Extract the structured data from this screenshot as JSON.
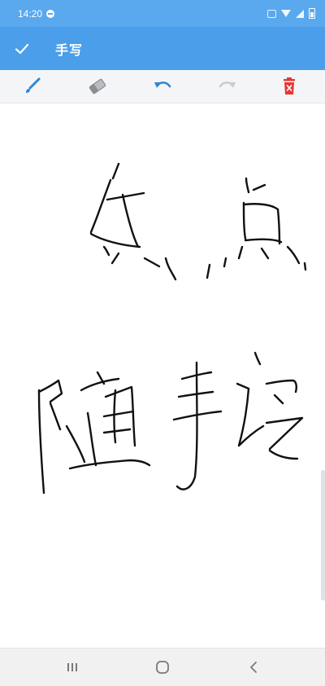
{
  "status_bar": {
    "time": "14:20"
  },
  "app_bar": {
    "title": "手写",
    "confirm_icon": "check-icon"
  },
  "toolbar": {
    "tools": [
      {
        "name": "brush-icon",
        "color": "#2f86d8"
      },
      {
        "name": "eraser-icon",
        "color": "#8a8d91"
      },
      {
        "name": "undo-icon",
        "color": "#2f86d8"
      },
      {
        "name": "redo-icon",
        "color": "#c9ccd0"
      },
      {
        "name": "delete-icon",
        "color": "#e53935"
      }
    ]
  },
  "canvas": {
    "handwriting_lines": [
      "点点",
      "随手记"
    ],
    "ink_color": "#111111"
  },
  "nav_bar": {
    "buttons": [
      "recent-apps-icon",
      "home-icon",
      "back-icon"
    ]
  },
  "colors": {
    "status_bar": "#5aa8ee",
    "app_bar": "#4a9eea",
    "toolbar_bg": "#f4f5f7"
  }
}
